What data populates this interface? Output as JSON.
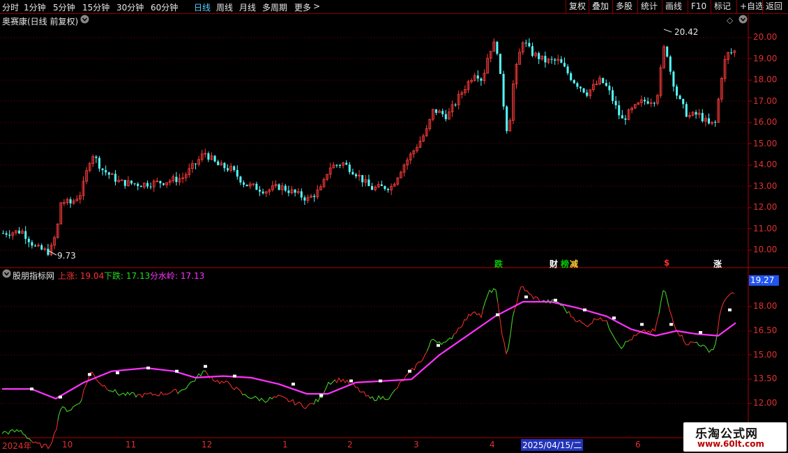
{
  "toolbar": {
    "periods": [
      "分时",
      "1分钟",
      "5分钟",
      "15分钟",
      "30分钟",
      "60分钟",
      "日线",
      "周线",
      "月线",
      "多周期",
      "更多"
    ],
    "active_period": "日线",
    "more_arrow": ">",
    "right_buttons": [
      "复权",
      "叠加",
      "多股",
      "统计",
      "画线",
      "F10",
      "标记",
      "+自选",
      "返回"
    ]
  },
  "main_panel": {
    "title": "奥赛康(日线 前复权)",
    "price_labels": [
      "20.00",
      "19.00",
      "18.00",
      "17.00",
      "16.00",
      "15.00",
      "14.00",
      "13.00",
      "12.00",
      "11.00",
      "10.00"
    ],
    "high_marker": "20.42",
    "low_marker": "9.73",
    "signals": [
      {
        "text": "跌",
        "color": "#00cc00"
      },
      {
        "text": "财",
        "color": "#ffffff"
      },
      {
        "text": "榜",
        "color": "#00cc00"
      },
      {
        "text": "减",
        "color": "#ffcc33"
      },
      {
        "text": "$",
        "color": "#ff3030"
      },
      {
        "text": "涨",
        "color": "#ffffff"
      }
    ]
  },
  "indicator_panel": {
    "name": "股朋指标网",
    "legend": [
      {
        "text": "上涨: 19.04",
        "color": "#ff3030"
      },
      {
        "text": "下跌: 17.13",
        "color": "#22dd22"
      },
      {
        "text": "分水岭: 17.13",
        "color": "#ff33ff"
      }
    ],
    "current_value": "19.27",
    "axis_labels": [
      "18.00",
      "16.50",
      "15.00",
      "13.50",
      "12.00"
    ]
  },
  "time_axis": {
    "labels": [
      "2024年",
      "10",
      "11",
      "12",
      "1",
      "2",
      "3",
      "4",
      "6"
    ],
    "cursor_date": "2025/04/15/二"
  },
  "watermark": {
    "line1": "乐淘公式网",
    "line2": "www.60lt.com"
  },
  "colors": {
    "up": "#ff3c3c",
    "down": "#54ffff",
    "grid": "#7a0000",
    "divider": "#b00000",
    "ma": "#ff33ff"
  }
}
